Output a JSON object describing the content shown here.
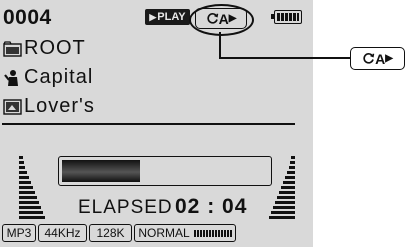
{
  "player": {
    "track_number": "0004",
    "play_state": "PLAY",
    "repeat_mode": "A",
    "battery_icon": "battery-full-icon"
  },
  "callout": {
    "label": "A"
  },
  "rows": {
    "folder": {
      "icon": "folder-icon",
      "text": "ROOT"
    },
    "artist": {
      "icon": "artist-icon",
      "text": "Capital"
    },
    "title": {
      "icon": "song-title-icon",
      "text": "Lover's"
    }
  },
  "progress": {
    "fraction": 0.38
  },
  "elapsed": {
    "label": "ELAPSED",
    "time": "02 : 04"
  },
  "status": {
    "format": "MP3",
    "sample_rate": "44KHz",
    "bitrate": "128K",
    "eq": "NORMAL"
  },
  "colors": {
    "lcd": "#d9d9d9",
    "ink": "#111111"
  }
}
